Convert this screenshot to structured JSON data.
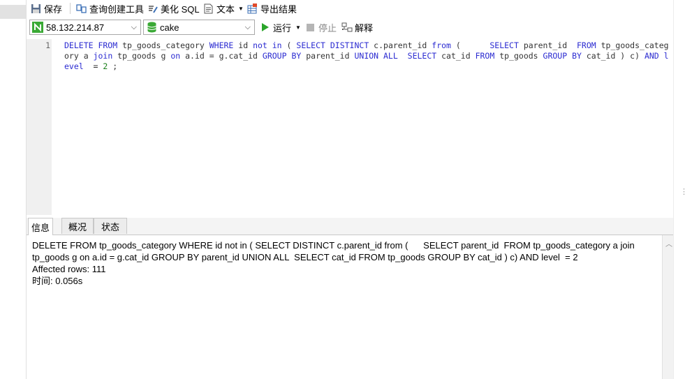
{
  "toolbar": {
    "save": "保存",
    "query_builder": "查询创建工具",
    "beautify_sql": "美化 SQL",
    "text": "文本",
    "export": "导出结果"
  },
  "connection": {
    "host": "58.132.214.87",
    "database": "cake",
    "run": "运行",
    "stop": "停止",
    "explain": "解释"
  },
  "editor": {
    "line_number": "1"
  },
  "tabs": {
    "info": "信息",
    "overview": "概况",
    "status": "状态"
  },
  "info": {
    "query": "DELETE FROM tp_goods_category WHERE id not in ( SELECT DISTINCT c.parent_id from (      SELECT parent_id  FROM tp_goods_category a join tp_goods g on a.id = g.cat_id GROUP BY parent_id UNION ALL  SELECT cat_id FROM tp_goods GROUP BY cat_id ) c) AND level  = 2",
    "affected": "Affected rows: 111",
    "time": "时间: 0.056s"
  },
  "colors": {
    "keyword": "#2b2bd1",
    "number": "#1a7f1a",
    "run_green": "#2aa52a",
    "db_green": "#3aa935"
  }
}
